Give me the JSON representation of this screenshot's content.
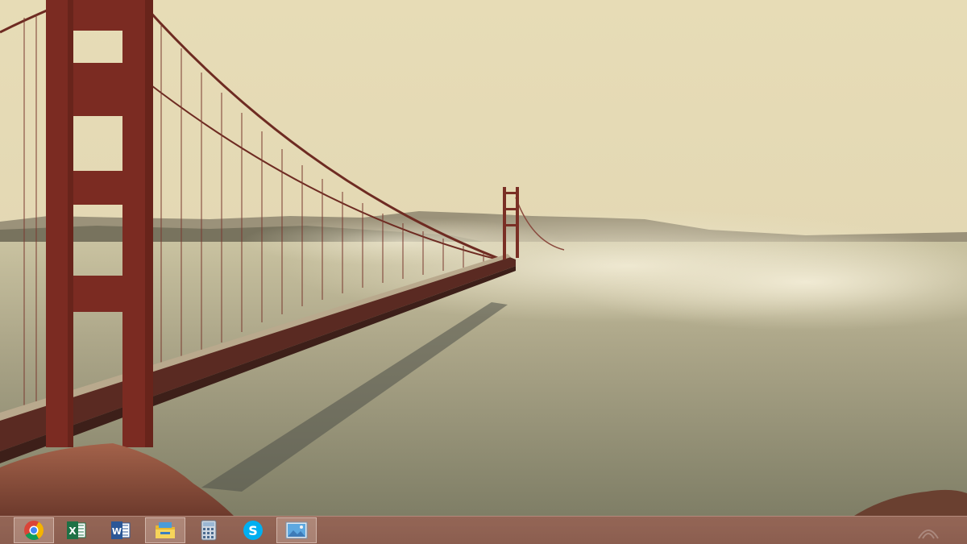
{
  "wallpaper": {
    "description_icon": "golden-gate-bridge-wallpaper"
  },
  "taskbar": {
    "background_color": "#8c5c4e",
    "items": [
      {
        "name": "chrome",
        "icon": "chrome-icon",
        "active": true
      },
      {
        "name": "excel",
        "icon": "excel-icon",
        "active": false
      },
      {
        "name": "word",
        "icon": "word-icon",
        "active": false
      },
      {
        "name": "file-explorer",
        "icon": "folder-icon",
        "active": true
      },
      {
        "name": "calculator",
        "icon": "calculator-icon",
        "active": false
      },
      {
        "name": "skype",
        "icon": "skype-icon",
        "active": false
      },
      {
        "name": "photos",
        "icon": "photo-viewer-icon",
        "active": true
      }
    ],
    "tray": {
      "icon": "network-icon"
    }
  },
  "colors": {
    "excel_green": "#1e7145",
    "word_blue": "#2b5797",
    "skype_blue": "#00aff0",
    "bridge_red": "#7a2a22"
  }
}
